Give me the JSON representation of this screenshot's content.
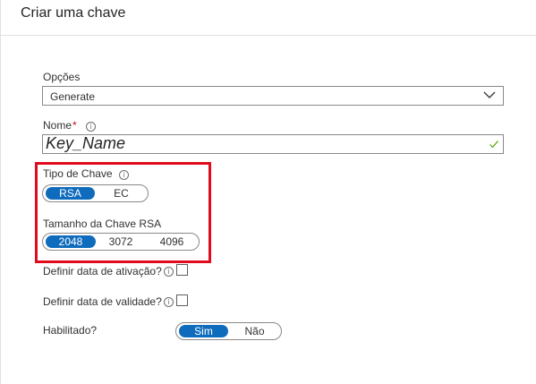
{
  "header": {
    "title": "Criar uma chave"
  },
  "options": {
    "label": "Opções",
    "selected": "Generate",
    "chevron_icon": "chevron-down-icon"
  },
  "name_field": {
    "label": "Nome",
    "required_marker": "*",
    "value": "Key_Name",
    "info_icon": "info-icon",
    "valid_icon": "checkmark-icon"
  },
  "key_type": {
    "label": "Tipo de Chave",
    "options": [
      "RSA",
      "EC"
    ],
    "selected": "RSA"
  },
  "rsa_key_size": {
    "label": "Tamanho da Chave RSA",
    "options": [
      "2048",
      "3072",
      "4096"
    ],
    "selected": "2048"
  },
  "activation_date": {
    "label": "Definir data de ativação?",
    "checked": false
  },
  "expiration_date": {
    "label": "Definir data de validade?",
    "checked": false
  },
  "enabled": {
    "label": "Habilitado?",
    "options": [
      "Sim",
      "Não"
    ],
    "selected": "Sim"
  },
  "colors": {
    "accent": "#0f6cbd",
    "highlight_border": "#e00b1c",
    "required": "#c50f1f",
    "valid_check": "#57a300"
  }
}
